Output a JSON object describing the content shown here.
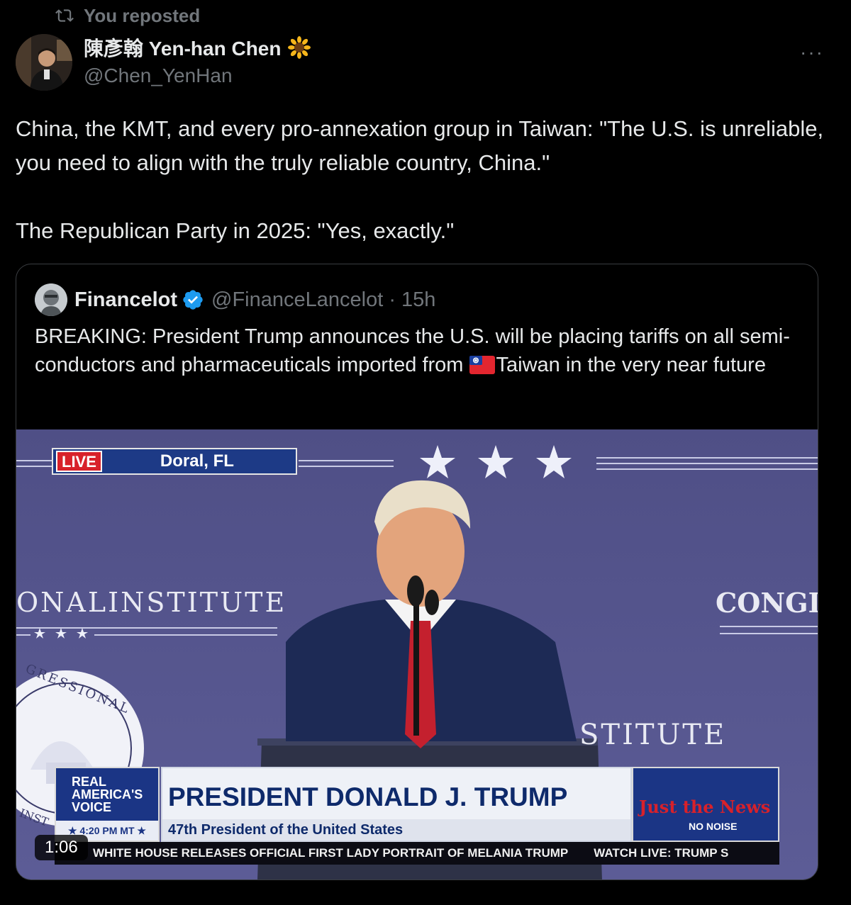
{
  "repost": {
    "icon": "repost-icon",
    "label": "You reposted"
  },
  "post": {
    "author_name": "陳彥翰 Yen-han Chen",
    "author_badge": "sunflower-emoji",
    "handle": "@Chen_YenHan",
    "more_label": "···",
    "text_p1": "China, the KMT, and every pro-annexation group in Taiwan: \"The U.S. is unreliable, you need to align with the truly reliable country, China.\"",
    "text_p2": "The Republican Party in 2025: \"Yes, exactly.\""
  },
  "quote": {
    "name": "Financelot",
    "verified": true,
    "handle_time": "@FinanceLancelot · 15h",
    "text_before_flag": "BREAKING: President Trump announces the U.S. will be placing tariffs on all semi-conductors and pharmaceuticals imported from ",
    "text_after_flag": "Taiwan in the very near future",
    "video": {
      "live_tag": "LIVE",
      "location": "Doral, FL",
      "wall_left": "ONALINSTITUTE",
      "wall_right": "CONGI",
      "wall_lower": "STITUTE",
      "seal_text": "GRESSIONAL",
      "seal_text_lower": "INST",
      "network_name": "REAL AMERICA'S VOICE",
      "network_time": "4:20 PM MT",
      "chyron_main": "PRESIDENT DONALD J. TRUMP",
      "chyron_sub": "47th President of the United States",
      "jtn_logo": "Just the News",
      "jtn_tagline": "NO NOISE",
      "ticker_1": "WHITE HOUSE RELEASES OFFICIAL FIRST LADY PORTRAIT OF MELANIA TRUMP",
      "ticker_2": "WATCH LIVE: TRUMP S",
      "duration": "1:06"
    }
  },
  "colors": {
    "background": "#000000",
    "text_primary": "#e7e9ea",
    "text_secondary": "#71767b",
    "border": "#3a3d41",
    "verified_blue": "#1d9bf0",
    "stage_purple": "#54548c"
  }
}
